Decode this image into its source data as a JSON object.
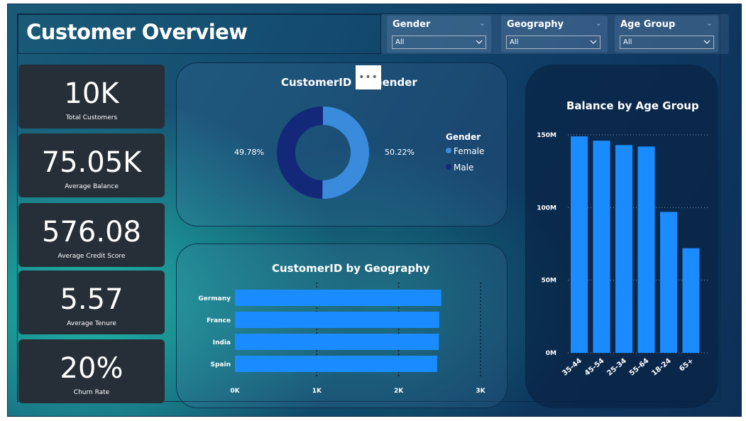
{
  "header": {
    "title": "Customer Overview"
  },
  "slicers": [
    {
      "label": "Gender",
      "value": "All"
    },
    {
      "label": "Geography",
      "value": "All"
    },
    {
      "label": "Age Group",
      "value": "All"
    }
  ],
  "kpis": [
    {
      "value": "10K",
      "label": "Total Customers"
    },
    {
      "value": "75.05K",
      "label": "Average Balance"
    },
    {
      "value": "576.08",
      "label": "Average Credit Score"
    },
    {
      "value": "5.57",
      "label": "Average Tenure"
    },
    {
      "value": "20%",
      "label": "Churn Rate"
    }
  ],
  "more_options": "•••",
  "colors": {
    "bar": "#1a8cff",
    "female": "#3a8bdc",
    "male": "#14287a"
  },
  "chart_data": [
    {
      "type": "pie",
      "title": "CustomerID by Gender",
      "legend_title": "Gender",
      "legend_position": "right",
      "categories": [
        "Female",
        "Male"
      ],
      "values": [
        50.22,
        49.78
      ],
      "value_labels": [
        "50.22%",
        "49.78%"
      ]
    },
    {
      "type": "bar",
      "orientation": "horizontal",
      "title": "CustomerID by Geography",
      "categories": [
        "Germany",
        "France",
        "India",
        "Spain"
      ],
      "values": [
        2520,
        2495,
        2490,
        2470
      ],
      "xlim": [
        0,
        3000
      ],
      "x_ticks": [
        "0K",
        "1K",
        "2K",
        "3K"
      ],
      "x_tick_values": [
        0,
        1000,
        2000,
        3000
      ]
    },
    {
      "type": "bar",
      "title": "Balance by Age Group",
      "categories": [
        "35-44",
        "45-54",
        "25-34",
        "55-64",
        "18-24",
        "65+"
      ],
      "values": [
        149000000,
        146000000,
        143000000,
        142000000,
        97000000,
        72000000
      ],
      "ylim": [
        0,
        150000000
      ],
      "y_ticks": [
        "0M",
        "50M",
        "100M",
        "150M"
      ],
      "y_tick_values": [
        0,
        50000000,
        100000000,
        150000000
      ],
      "grid": true
    }
  ]
}
